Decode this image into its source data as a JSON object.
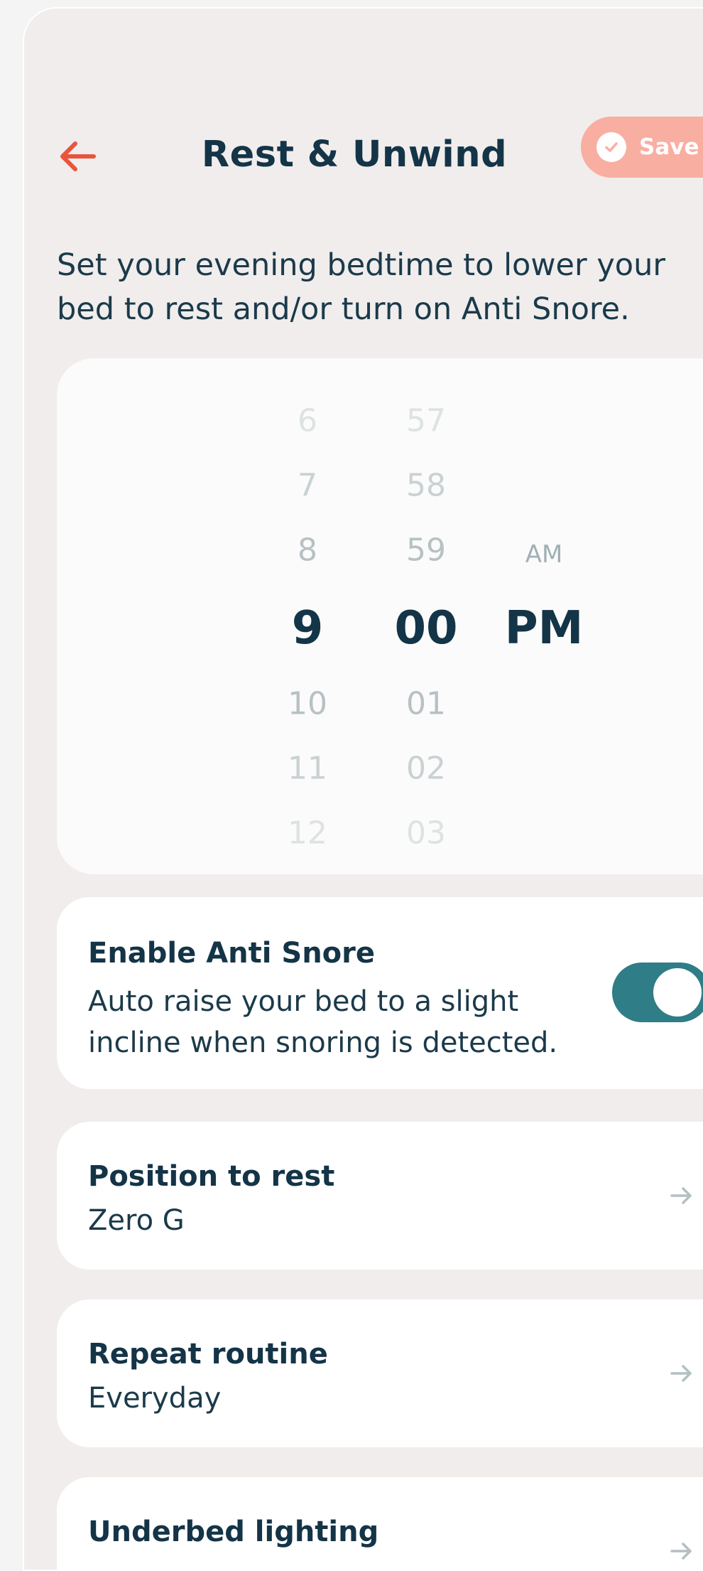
{
  "header": {
    "title": "Rest & Unwind",
    "save_label": "Save"
  },
  "intro_text": "Set your evening bedtime to lower your bed to rest and/or turn on Anti Snore.",
  "time_picker": {
    "hours": [
      "6",
      "7",
      "8",
      "9",
      "10",
      "11",
      "12"
    ],
    "minutes": [
      "57",
      "58",
      "59",
      "00",
      "01",
      "02",
      "03"
    ],
    "meridiem": [
      "AM",
      "PM"
    ],
    "selected": {
      "hour": "9",
      "minute": "00",
      "meridiem": "PM"
    }
  },
  "anti_snore": {
    "title": "Enable Anti Snore",
    "description_line1": "Auto raise your bed to a slight",
    "description_line2": "incline when snoring is detected.",
    "enabled": true
  },
  "settings": [
    {
      "title": "Position to rest",
      "value": "Zero G"
    },
    {
      "title": "Repeat routine",
      "value": "Everyday"
    },
    {
      "title": "Underbed lighting",
      "value": ""
    }
  ],
  "colors": {
    "accent": "#e8553c",
    "save_bg": "#f9aea2",
    "toggle_on": "#2f7d86",
    "text_dark": "#143447",
    "background": "#f0edec"
  }
}
